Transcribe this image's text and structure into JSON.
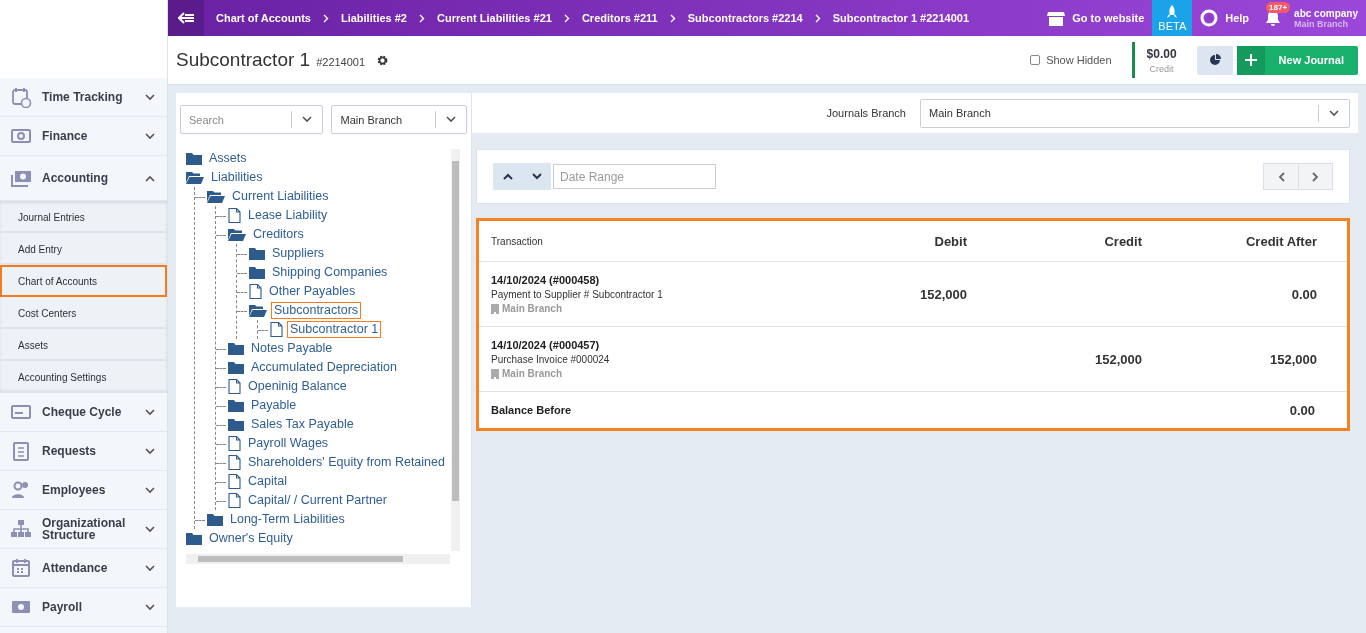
{
  "sidebar": {
    "groups": [
      {
        "label": "Time Tracking",
        "expanded": false
      },
      {
        "label": "Finance",
        "expanded": false
      },
      {
        "label": "Accounting",
        "expanded": true,
        "children": [
          {
            "label": "Journal Entries",
            "highlighted": false
          },
          {
            "label": "Add Entry",
            "highlighted": false
          },
          {
            "label": "Chart of Accounts",
            "highlighted": true
          },
          {
            "label": "Cost Centers",
            "highlighted": false
          },
          {
            "label": "Assets",
            "highlighted": false
          },
          {
            "label": "Accounting Settings",
            "highlighted": false
          }
        ]
      },
      {
        "label": "Cheque Cycle",
        "expanded": false
      },
      {
        "label": "Requests",
        "expanded": false
      },
      {
        "label": "Employees",
        "expanded": false
      },
      {
        "label": "Organizational Structure",
        "expanded": false
      },
      {
        "label": "Attendance",
        "expanded": false
      },
      {
        "label": "Payroll",
        "expanded": false
      }
    ]
  },
  "top_bar": {
    "breadcrumbs": [
      "Chart of Accounts",
      "Liabilities #2",
      "Current Liabilities #21",
      "Creditors #211",
      "Subcontractors #2214",
      "Subcontractor 1 #2214001"
    ],
    "go_to_website": "Go to website",
    "beta": "BETA",
    "help": "Help",
    "notification_count": "187+",
    "company": "abc company",
    "branch": "Main Branch"
  },
  "header": {
    "title": "Subcontractor 1",
    "code": "#2214001",
    "show_hidden": {
      "label": "Show Hidden",
      "checked": false
    },
    "balance": {
      "amount": "$0.00",
      "label": "Credit"
    },
    "new_journal": "New Journal"
  },
  "tree_panel": {
    "search": {
      "placeholder": "Search"
    },
    "branch": "Main Branch",
    "tree": [
      {
        "label": "Assets",
        "kind": "folder",
        "expanded": false,
        "highlighted": false
      },
      {
        "label": "Liabilities",
        "kind": "folder",
        "expanded": true,
        "highlighted": false,
        "children": [
          {
            "label": "Current Liabilities",
            "kind": "folder",
            "expanded": true,
            "highlighted": false,
            "children": [
              {
                "label": "Lease Liability",
                "kind": "file",
                "highlighted": false
              },
              {
                "label": "Creditors",
                "kind": "folder",
                "expanded": true,
                "highlighted": false,
                "children": [
                  {
                    "label": "Suppliers",
                    "kind": "folder",
                    "expanded": false,
                    "highlighted": false
                  },
                  {
                    "label": "Shipping Companies",
                    "kind": "folder",
                    "expanded": false,
                    "highlighted": false
                  },
                  {
                    "label": "Other Payables",
                    "kind": "file",
                    "highlighted": false
                  },
                  {
                    "label": "Subcontractors",
                    "kind": "folder",
                    "expanded": true,
                    "highlighted": true,
                    "children": [
                      {
                        "label": "Subcontractor 1",
                        "kind": "file",
                        "highlighted": true
                      }
                    ]
                  }
                ]
              },
              {
                "label": "Notes Payable",
                "kind": "folder",
                "expanded": false,
                "highlighted": false
              },
              {
                "label": "Accumulated Depreciation",
                "kind": "folder",
                "expanded": false,
                "highlighted": false
              },
              {
                "label": "Openinig Balance",
                "kind": "file",
                "highlighted": false
              },
              {
                "label": "Payable",
                "kind": "folder",
                "expanded": false,
                "highlighted": false
              },
              {
                "label": "Sales Tax Payable",
                "kind": "folder",
                "expanded": false,
                "highlighted": false
              },
              {
                "label": "Payroll Wages",
                "kind": "file",
                "highlighted": false
              },
              {
                "label": "Shareholders' Equity from Retained",
                "kind": "file",
                "highlighted": false
              },
              {
                "label": "Capital",
                "kind": "file",
                "highlighted": false
              },
              {
                "label": "Capital/ / Current Partner",
                "kind": "file",
                "highlighted": false
              }
            ]
          },
          {
            "label": "Long-Term Liabilities",
            "kind": "folder",
            "expanded": false,
            "highlighted": false
          }
        ]
      },
      {
        "label": "Owner's Equity",
        "kind": "folder",
        "expanded": false,
        "highlighted": false
      }
    ]
  },
  "journals": {
    "branch_label": "Journals Branch",
    "branch": "Main Branch",
    "date_range": {
      "placeholder": "Date Range"
    },
    "table": {
      "highlighted": true,
      "columns": [
        "Transaction",
        "Debit",
        "Credit",
        "Credit After"
      ],
      "rows": [
        {
          "date": "14/10/2024 (#000458)",
          "description": "Payment to Supplier # Subcontractor 1",
          "branch": "Main Branch",
          "debit": "152,000",
          "credit_after": "0.00"
        },
        {
          "date": "14/10/2024 (#000457)",
          "description": "Purchase Invoice #000024",
          "branch": "Main Branch",
          "credit": "152,000",
          "credit_after": "152,000"
        }
      ],
      "footer": {
        "label": "Balance Before",
        "value": "0.00"
      }
    }
  }
}
